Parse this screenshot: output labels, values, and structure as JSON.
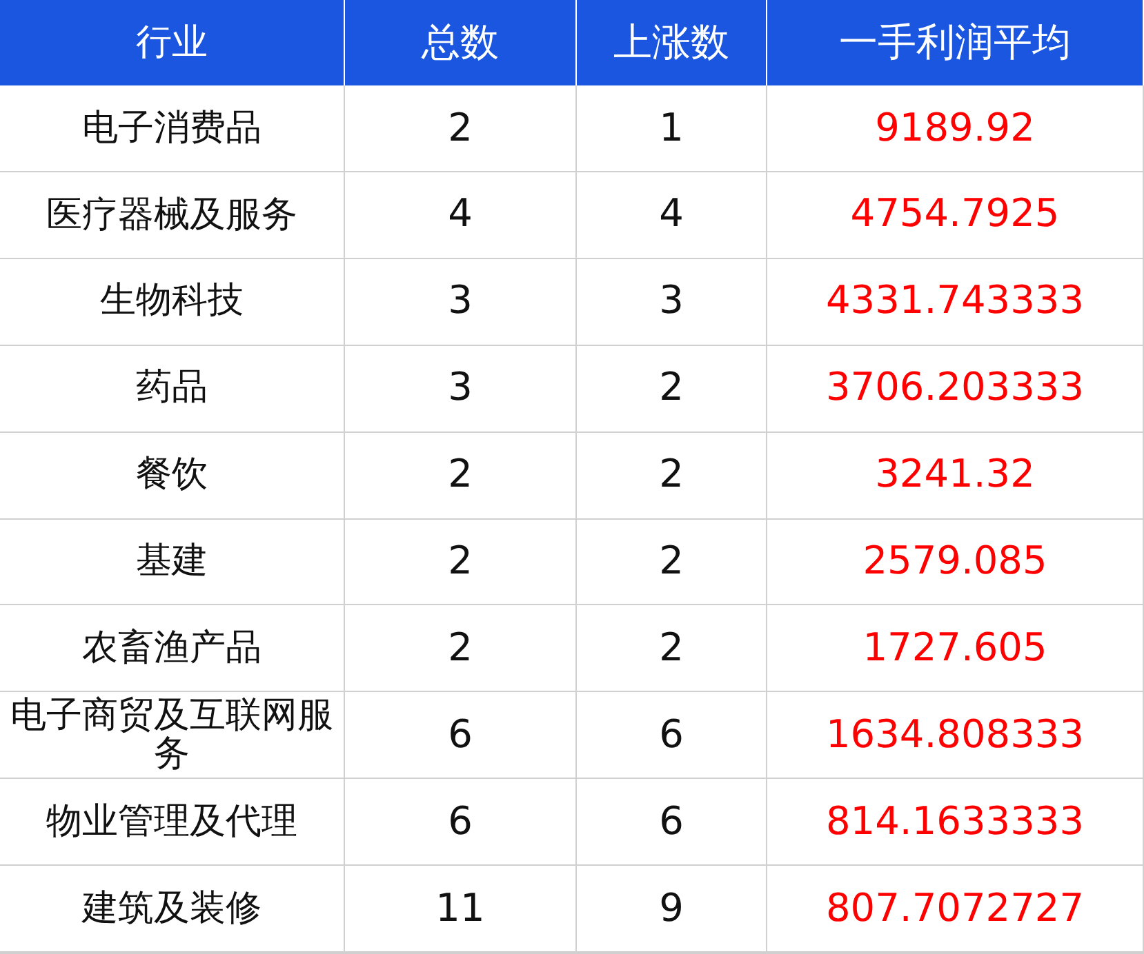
{
  "table": {
    "columns": [
      "行业",
      "总数",
      "上涨数",
      "一手利润平均"
    ],
    "rows": [
      [
        "电子消费品",
        "2",
        "1",
        "9189.92"
      ],
      [
        "医疗器械及服务",
        "4",
        "4",
        "4754.7925"
      ],
      [
        "生物科技",
        "3",
        "3",
        "4331.743333"
      ],
      [
        "药品",
        "3",
        "2",
        "3706.203333"
      ],
      [
        "餐饮",
        "2",
        "2",
        "3241.32"
      ],
      [
        "基建",
        "2",
        "2",
        "2579.085"
      ],
      [
        "农畜渔产品",
        "2",
        "2",
        "1727.605"
      ],
      [
        "电子商贸及互联网服务",
        "6",
        "6",
        "1634.808333"
      ],
      [
        "物业管理及代理",
        "6",
        "6",
        "814.1633333"
      ],
      [
        "建筑及装修",
        "11",
        "9",
        "807.7072727"
      ]
    ]
  }
}
